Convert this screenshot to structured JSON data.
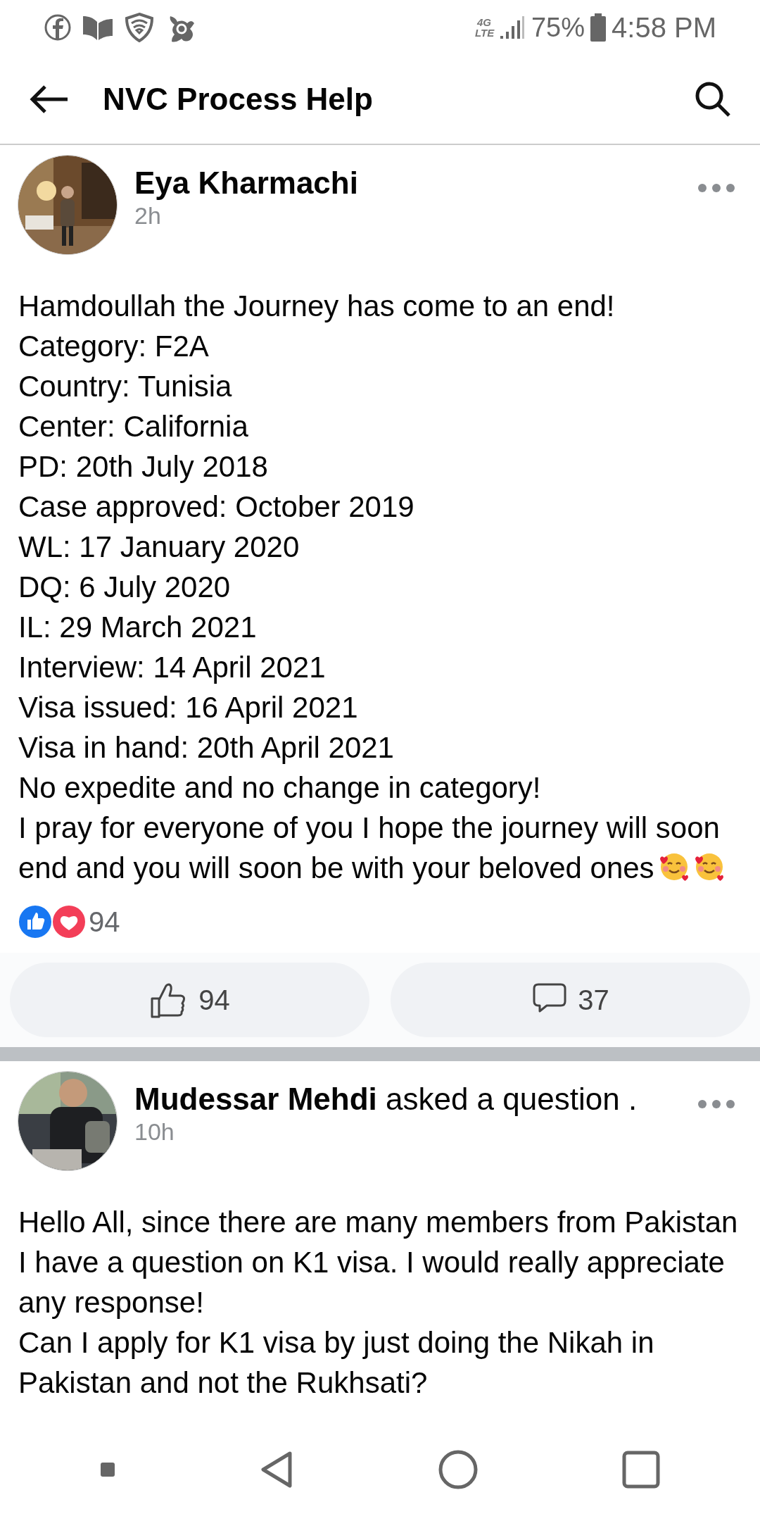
{
  "status_bar": {
    "battery": "75%",
    "time": "4:58 PM",
    "network": "4G LTE"
  },
  "header": {
    "title": "NVC Process Help"
  },
  "posts": [
    {
      "author": "Eya Kharmachi",
      "time": "2h",
      "lines": [
        "Hamdoullah the Journey has come to an end!",
        "Category: F2A",
        "Country: Tunisia",
        "Center: California",
        "PD: 20th July 2018",
        "Case approved: October 2019",
        "WL: 17 January 2020",
        "DQ: 6 July 2020",
        "IL: 29 March 2021",
        "Interview: 14 April 2021",
        "Visa issued: 16 April 2021",
        "Visa in hand: 20th April 2021",
        "No expedite and no change in category!",
        "I pray for everyone of you I hope the journey will soon end and you will soon be with your beloved ones"
      ],
      "trailing_emoji": true,
      "reactions_count": "94",
      "like_count": "94",
      "comment_count": "37"
    },
    {
      "author": "Mudessar Mehdi",
      "action": "asked a question .",
      "time": "10h",
      "lines": [
        "Hello All, since there are many members from Pakistan I have a question on K1 visa. I would really appreciate any response!",
        "Can I apply for K1 visa by just doing the Nikah in Pakistan and not the Rukhsati?"
      ]
    }
  ]
}
